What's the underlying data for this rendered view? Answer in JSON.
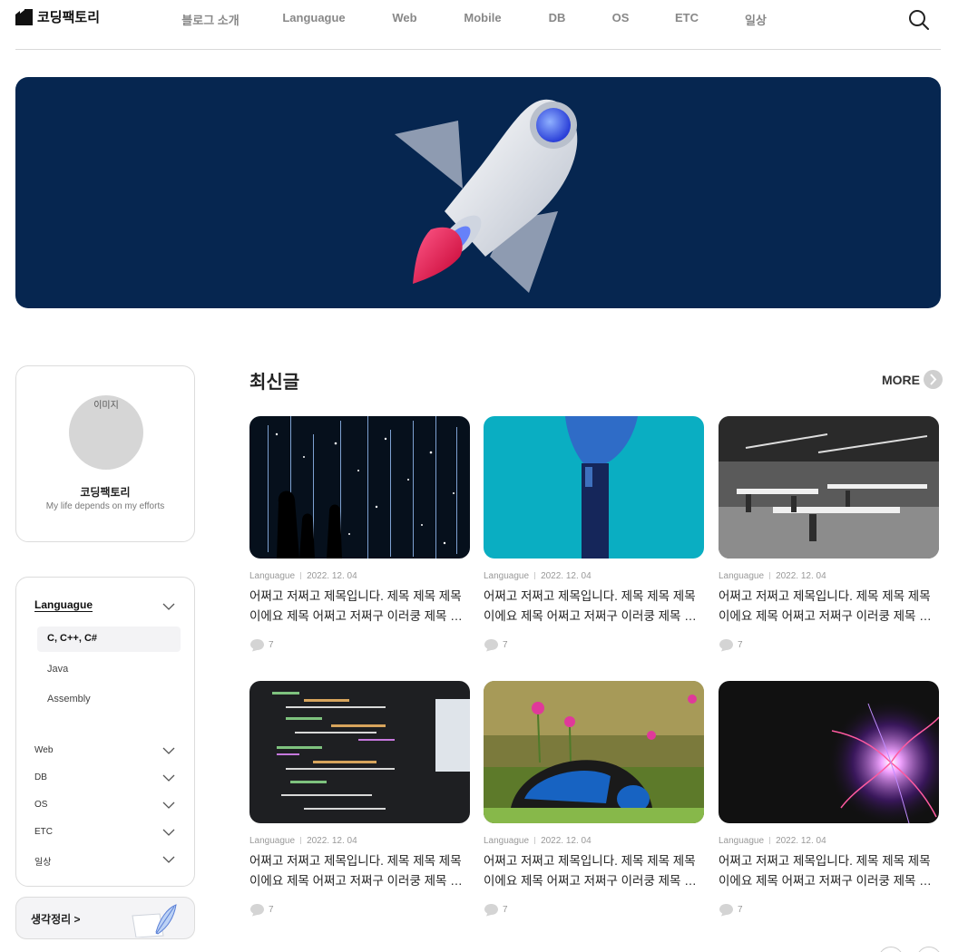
{
  "header": {
    "logo_text": "코딩팩토리",
    "nav": [
      "블로그 소개",
      "Languague",
      "Web",
      "Mobile",
      "DB",
      "OS",
      "ETC",
      "일상"
    ],
    "search_icon": "search-icon"
  },
  "hero": {
    "image": "rocket-illustration",
    "background": "#062650"
  },
  "profile": {
    "image_placeholder": "이미지",
    "name": "코딩팩토리",
    "description": "My life depends on my efforts"
  },
  "categories": {
    "main": "Languague",
    "subitems": [
      "C, C++, C#",
      "Java",
      "Assembly"
    ],
    "active_subitem": "C, C++, C#",
    "others": [
      "Web",
      "DB",
      "OS",
      "ETC",
      "일상"
    ]
  },
  "thoughts_button": {
    "label": "생각정리 >"
  },
  "latest": {
    "title": "최신글",
    "more_label": "MORE",
    "posts": [
      {
        "category": "Languague",
        "date": "2022. 12. 04",
        "title": "어쩌고 저쩌고 제목입니다. 제목 제목 제목 이에요 제목 어쩌고 저쩌구 이러쿵 제목 제목",
        "comments": "7",
        "image": "space-lights"
      },
      {
        "category": "Languague",
        "date": "2022. 12. 04",
        "title": "어쩌고 저쩌고 제목입니다. 제목 제목 제목 이에요 제목 어쩌고 저쩌구 이러쿵 제목 제목",
        "comments": "7",
        "image": "robot-hand"
      },
      {
        "category": "Languague",
        "date": "2022. 12. 04",
        "title": "어쩌고 저쩌고 제목입니다. 제목 제목 제목 이에요 제목 어쩌고 저쩌구 이러쿵 제목 제목",
        "comments": "7",
        "image": "office-room"
      },
      {
        "category": "Languague",
        "date": "2022. 12. 04",
        "title": "어쩌고 저쩌고 제목입니다. 제목 제목 제목 이에요 제목 어쩌고 저쩌구 이러쿵 제목 제목",
        "comments": "7",
        "image": "code-screen"
      },
      {
        "category": "Languague",
        "date": "2022. 12. 04",
        "title": "어쩌고 저쩌고 제목입니다. 제목 제목 제목 이에요 제목 어쩌고 저쩌구 이러쿵 제목 제목",
        "comments": "7",
        "image": "headphones-flowers"
      },
      {
        "category": "Languague",
        "date": "2022. 12. 04",
        "title": "어쩌고 저쩌고 제목입니다. 제목 제목 제목 이에요 제목 어쩌고 저쩌구 이러쿵 제목 제목",
        "comments": "7",
        "image": "plasma-ball"
      }
    ]
  }
}
